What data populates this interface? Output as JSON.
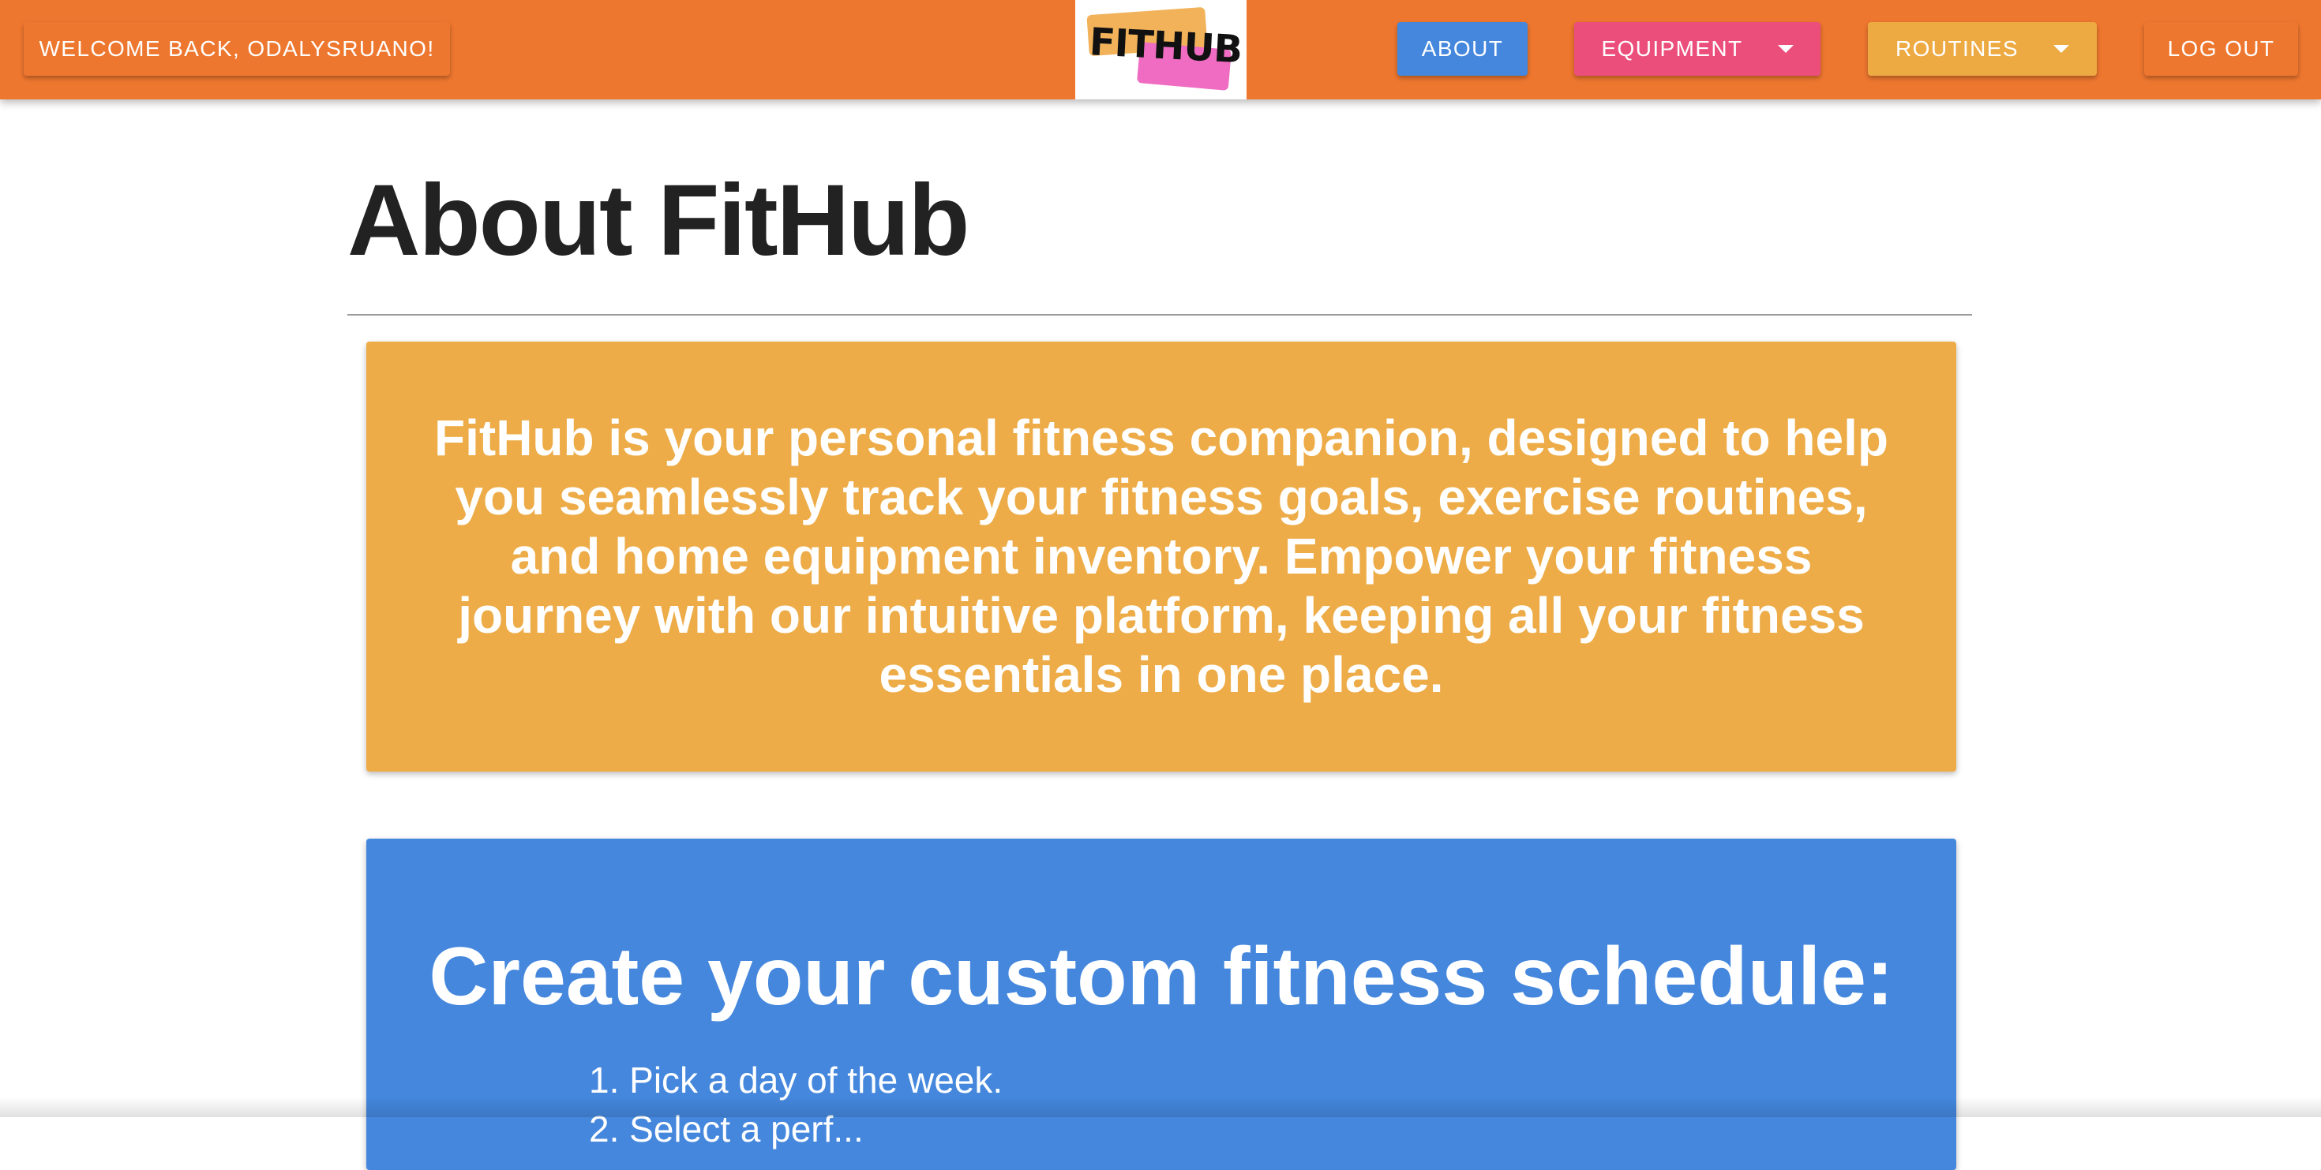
{
  "header": {
    "welcome_label": "WELCOME BACK, ODALYSRUANO!",
    "logo_text": "FITHUB",
    "nav": {
      "about_label": "ABOUT",
      "equipment_label": "EQUIPMENT",
      "routines_label": "ROUTINES",
      "logout_label": "LOG OUT"
    }
  },
  "main": {
    "title": "About FitHub",
    "about_card": {
      "text": "FitHub is your personal fitness companion, designed to help you seamlessly track your fitness goals, exercise routines, and home equipment inventory. Empower your fitness journey with our intuitive platform, keeping all your fitness essentials in one place."
    },
    "schedule_card": {
      "heading": "Create your custom fitness schedule:",
      "steps": [
        "1. Pick a day of the week.",
        "2. Select a perf..."
      ]
    }
  },
  "colors": {
    "header_bg": "#ee772f",
    "about_button": "#4487dd",
    "equipment_button": "#ec4e7c",
    "routines_button": "#edaa43",
    "about_card_bg": "#edac47",
    "schedule_card_bg": "#4487dd"
  },
  "icons": {
    "dropdown": "chevron-down-icon"
  }
}
